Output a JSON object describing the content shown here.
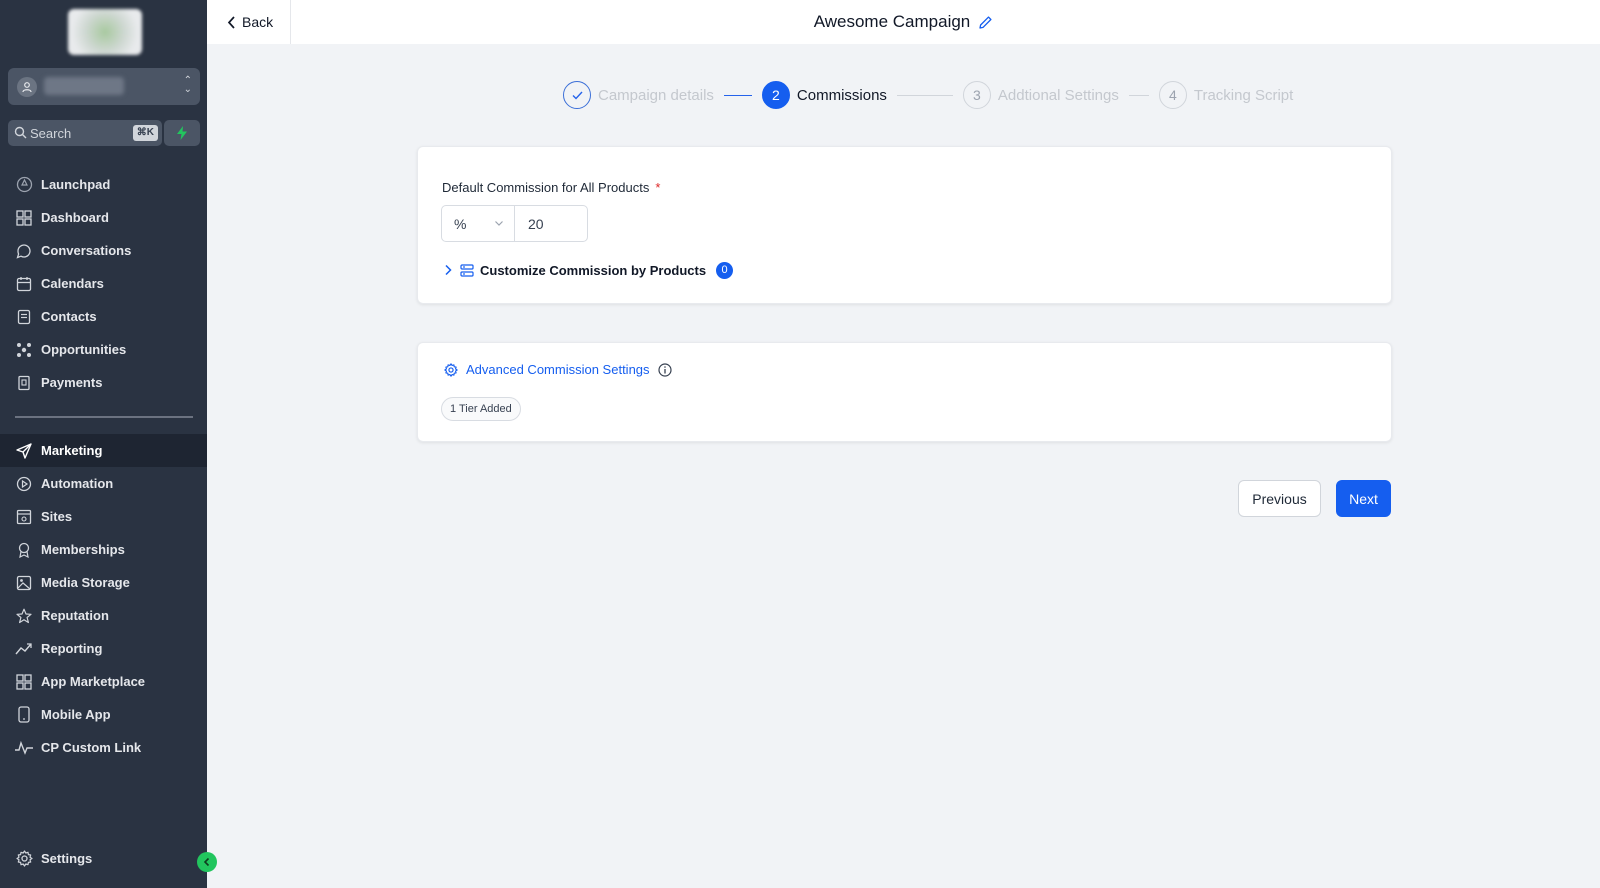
{
  "sidebar": {
    "search_label": "Search",
    "search_shortcut": "⌘K",
    "items": [
      {
        "label": "Launchpad",
        "icon": "rocket-icon"
      },
      {
        "label": "Dashboard",
        "icon": "grid-icon"
      },
      {
        "label": "Conversations",
        "icon": "chat-icon"
      },
      {
        "label": "Calendars",
        "icon": "calendar-icon"
      },
      {
        "label": "Contacts",
        "icon": "contacts-icon"
      },
      {
        "label": "Opportunities",
        "icon": "opportunities-icon"
      },
      {
        "label": "Payments",
        "icon": "payments-icon"
      },
      {
        "label": "Marketing",
        "icon": "send-icon",
        "active": true
      },
      {
        "label": "Automation",
        "icon": "automation-icon"
      },
      {
        "label": "Sites",
        "icon": "sites-icon"
      },
      {
        "label": "Memberships",
        "icon": "award-icon"
      },
      {
        "label": "Media Storage",
        "icon": "image-icon"
      },
      {
        "label": "Reputation",
        "icon": "star-icon"
      },
      {
        "label": "Reporting",
        "icon": "trend-icon"
      },
      {
        "label": "App Marketplace",
        "icon": "apps-icon"
      },
      {
        "label": "Mobile App",
        "icon": "mobile-icon"
      },
      {
        "label": "CP Custom Link",
        "icon": "pulse-icon"
      }
    ],
    "settings_label": "Settings"
  },
  "header": {
    "back_label": "Back",
    "title": "Awesome Campaign"
  },
  "stepper": {
    "steps": [
      {
        "number": "1",
        "label": "Campaign details",
        "state": "done"
      },
      {
        "number": "2",
        "label": "Commissions",
        "state": "current"
      },
      {
        "number": "3",
        "label": "Addtional Settings",
        "state": "upcoming"
      },
      {
        "number": "4",
        "label": "Tracking Script",
        "state": "upcoming"
      }
    ]
  },
  "commission": {
    "label": "Default Commission for All Products",
    "required_mark": "*",
    "unit": "%",
    "value": "20",
    "customize_label": "Customize Commission by Products",
    "customize_count": "0"
  },
  "advanced": {
    "label": "Advanced Commission Settings",
    "tier_chip": "1 Tier Added"
  },
  "actions": {
    "previous_label": "Previous",
    "next_label": "Next"
  },
  "colors": {
    "sidebar_bg": "#2a3342",
    "primary": "#155eef",
    "page_bg": "#f1f3f6"
  }
}
